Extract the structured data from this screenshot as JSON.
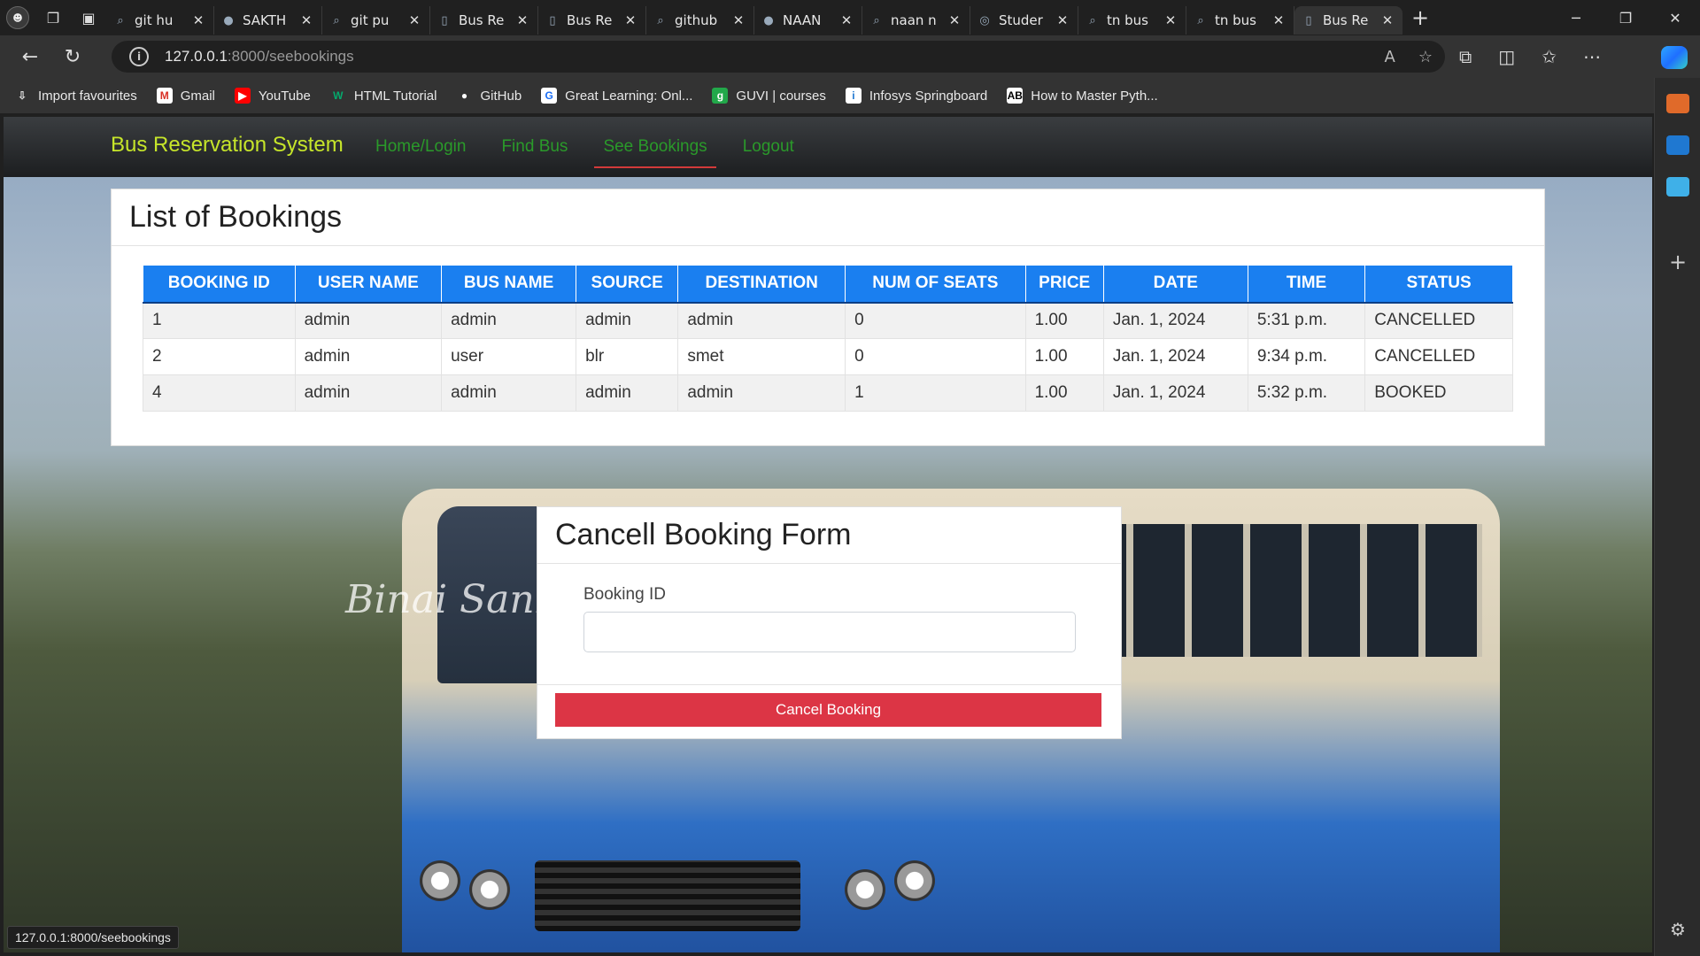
{
  "browser": {
    "tabs": [
      {
        "title": "git hu",
        "icon": "search-icon"
      },
      {
        "title": "SAKTH",
        "icon": "github-icon"
      },
      {
        "title": "git pu",
        "icon": "search-icon"
      },
      {
        "title": "Bus Re",
        "icon": "page-icon"
      },
      {
        "title": "Bus Re",
        "icon": "page-icon"
      },
      {
        "title": "github",
        "icon": "search-icon"
      },
      {
        "title": "NAAN",
        "icon": "github-icon"
      },
      {
        "title": "naan n",
        "icon": "search-icon"
      },
      {
        "title": "Studer",
        "icon": "app-icon"
      },
      {
        "title": "tn bus",
        "icon": "search-icon"
      },
      {
        "title": "tn bus",
        "icon": "search-icon"
      },
      {
        "title": "Bus Re",
        "icon": "page-icon",
        "active": true
      }
    ],
    "url_host": "127.0.0.1",
    "url_path": ":8000/seebookings",
    "favourites": [
      {
        "label": "Import favourites",
        "icon": "import-icon"
      },
      {
        "label": "Gmail",
        "icon": "gmail-icon"
      },
      {
        "label": "YouTube",
        "icon": "youtube-icon"
      },
      {
        "label": "HTML Tutorial",
        "icon": "w3schools-icon"
      },
      {
        "label": "GitHub",
        "icon": "github-icon"
      },
      {
        "label": "Great Learning: Onl...",
        "icon": "greatlearning-icon"
      },
      {
        "label": "GUVI | courses",
        "icon": "guvi-icon"
      },
      {
        "label": "Infosys Springboard",
        "icon": "infosys-icon"
      },
      {
        "label": "How to Master Pyth...",
        "icon": "ab-icon"
      }
    ],
    "status_url": "127.0.0.1:8000/seebookings"
  },
  "navbar": {
    "brand": "Bus Reservation System",
    "links": [
      "Home/Login",
      "Find Bus",
      "See Bookings",
      "Logout"
    ],
    "active_link": "See Bookings",
    "brand_color": "#c6e52a",
    "link_color": "#2a9a2a"
  },
  "bookings": {
    "title": "List of Bookings",
    "columns": [
      "BOOKING ID",
      "USER NAME",
      "BUS NAME",
      "SOURCE",
      "DESTINATION",
      "NUM OF SEATS",
      "PRICE",
      "DATE",
      "TIME",
      "STATUS"
    ],
    "rows": [
      [
        "1",
        "admin",
        "admin",
        "admin",
        "admin",
        "0",
        "1.00",
        "Jan. 1, 2024",
        "5:31 p.m.",
        "CANCELLED"
      ],
      [
        "2",
        "admin",
        "user",
        "blr",
        "smet",
        "0",
        "1.00",
        "Jan. 1, 2024",
        "9:34 p.m.",
        "CANCELLED"
      ],
      [
        "4",
        "admin",
        "admin",
        "admin",
        "admin",
        "1",
        "1.00",
        "Jan. 1, 2024",
        "5:32 p.m.",
        "BOOKED"
      ]
    ],
    "header_color": "#1a7ff0"
  },
  "cancel_form": {
    "title": "Cancell Booking Form",
    "field_label": "Booking ID",
    "field_value": "",
    "button_label": "Cancel Booking",
    "button_color": "#dc3545"
  },
  "background": {
    "watermark": "Binai Sanka"
  }
}
